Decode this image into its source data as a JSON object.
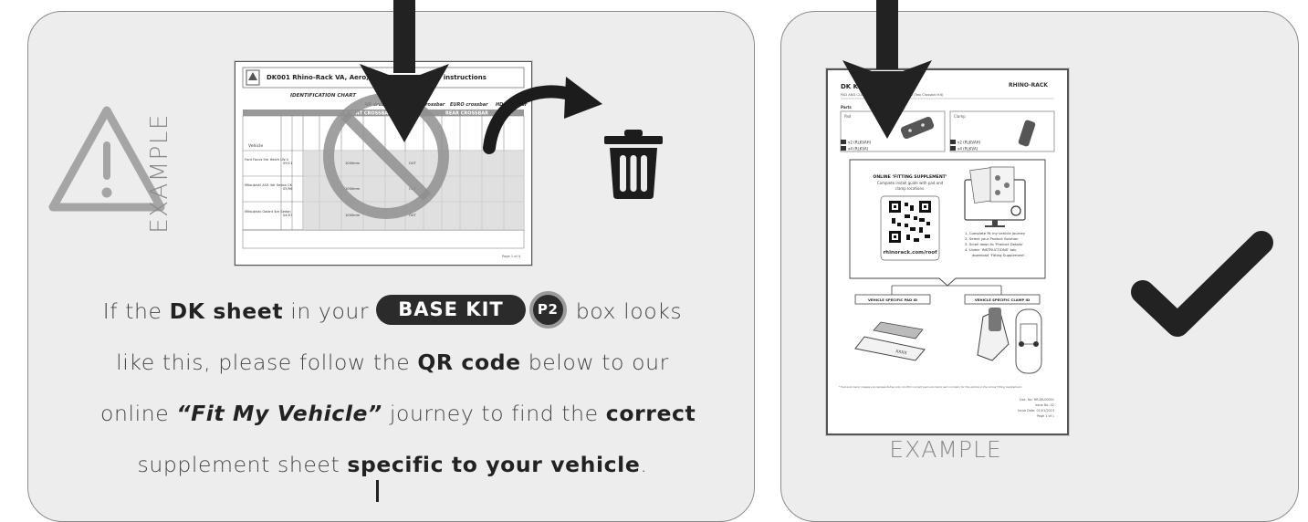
{
  "left_panel": {
    "example_label": "EXAMPLE",
    "doc": {
      "title": "DK001 Rhino-Rack VA, Aero, Euro & HD crossbar instructions",
      "id_chart_label": "IDENTIFICATION CHART",
      "crossbar_labels": [
        "VA crossbar",
        "AERO crossbar",
        "EURO crossbar",
        "HD crossbar"
      ],
      "front_label": "FRONT CROSSBAR",
      "rear_label": "REAR CROSSBAR",
      "vehicle_header": "Vehicle",
      "rows": [
        {
          "vehicle": "Ford Focus 5dr Hatch LW-II",
          "date": "09/11",
          "meas": "1000mm",
          "out": "OUT"
        },
        {
          "vehicle": "Mitsubishi ASX 4dr Sedan CK",
          "date": "05/96",
          "meas": "1000mm",
          "out": "OUT"
        },
        {
          "vehicle": "Mitsubishi Galant 4dr Sedan",
          "date": "04/07",
          "meas": "1000mm",
          "out": "OUT"
        }
      ],
      "page_label": "Page 1 of 4"
    },
    "message": {
      "line1_pre": "If the ",
      "line1_bold": "DK sheet",
      "line1_mid": " in your ",
      "base_kit": "BASE KIT",
      "p2": "P2",
      "line1_post": " box looks",
      "line2_pre": "like this, please follow the ",
      "line2_bold": "QR code",
      "line2_post": " below to our",
      "line3_pre": "online ",
      "line3_bi": "“Fit My Vehicle”",
      "line3_mid": " journey to find the ",
      "line3_bold": "correct",
      "line4_pre": "supplement sheet ",
      "line4_bold": "specific to your vehicle",
      "line4_post": "."
    }
  },
  "right_panel": {
    "example_label": "EXAMPLE",
    "doc": {
      "title": "DK KIT",
      "subtitle": "PAD AND CLAMP  (One Crossbar Kit) | RLKVA (Two Crossbar Kit)",
      "brand": "RHINO-RACK",
      "parts_label": "Parts",
      "pad_label": "Pad",
      "clamp_label": "Clamp",
      "pad_qty1": "x2 (RLKVAH)",
      "pad_qty2": "x4 (RLKVA)",
      "clamp_qty1": "x2 (RLKVAH)",
      "clamp_qty2": "x4 (RLKVA)",
      "online_title": "ONLINE ‘FITTING SUPPLEMENT’",
      "online_sub1": "Complete install guide with pad and",
      "online_sub2": "clamp locations.",
      "qr_url": "rhinorack.com/roof",
      "steps": [
        "1. Complete Fit my vehicle journey",
        "2. Select your Product Solution",
        "3. Scroll down to ‘Product Details’",
        "4. Under ‘INSTRUCTIONS’ tab,",
        "download ‘Fitting Supplement’."
      ],
      "pad_id_label": "VEHICLE SPECIFIC PAD ID",
      "clamp_id_label": "VEHICLE SPECIFIC CLAMP ID",
      "pad_code": "XXXX",
      "footnote": "* Pad and clamp images are representative only. Confirm correct pad and clamp part numbers for the vehicle in the online Fitting Supplement.",
      "doc_no": "Doc. No: RR-DK-00001",
      "issue_no": "Issue No: 02",
      "issue_date": "Issue Date: 01/01/2023",
      "page": "Page 1 of 1"
    }
  },
  "colors": {
    "panel_bg": "#ededed",
    "panel_border": "#8c8c8c",
    "dark": "#2b2b2b",
    "muted": "#8a8a8a"
  }
}
